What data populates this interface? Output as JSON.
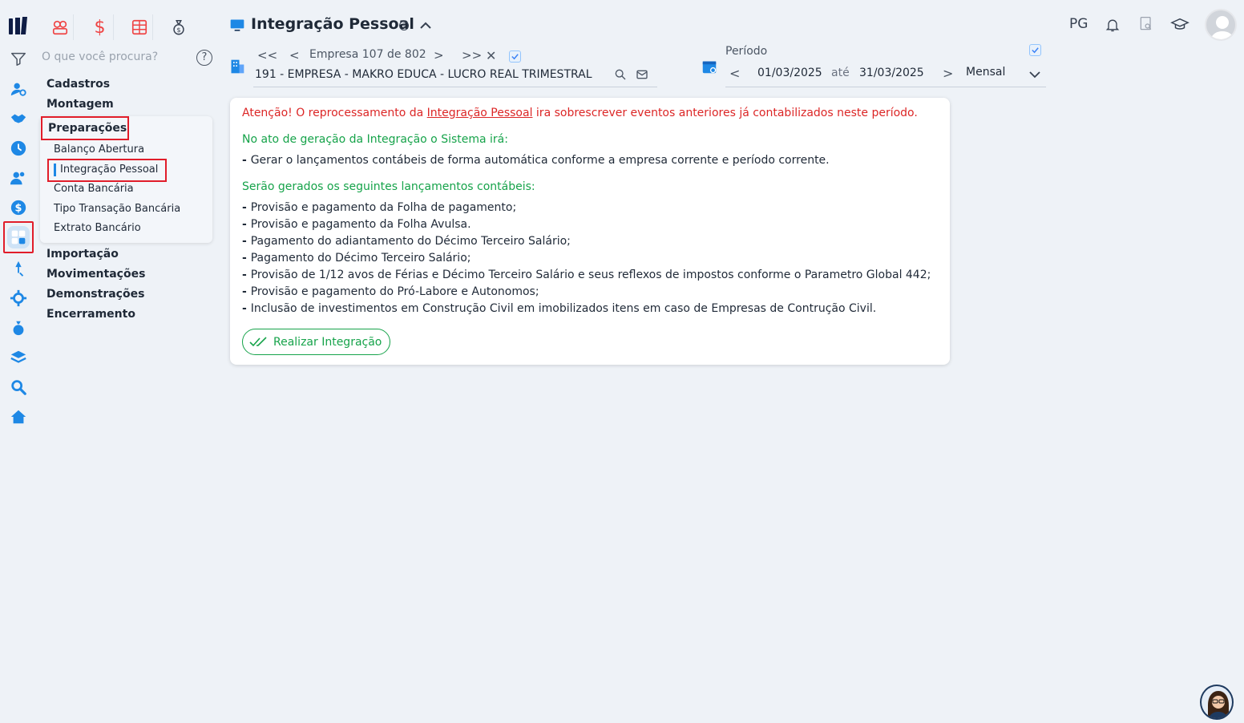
{
  "app": {
    "logo": "logo",
    "page_title": "Integração Pessoal",
    "user_initials": "PG"
  },
  "top_apps": [
    {
      "icon": "people-icon"
    },
    {
      "icon": "dollar-icon"
    },
    {
      "icon": "calculator-grid-icon"
    },
    {
      "icon": "money-bag-icon"
    }
  ],
  "menu": {
    "search_placeholder": "O que você procura?",
    "groups": [
      "Cadastros",
      "Montagem",
      "Preparações",
      "Importação",
      "Movimentações",
      "Demonstrações",
      "Encerramento"
    ],
    "preparacoes_items": [
      "Balanço Abertura",
      "Integração Pessoal",
      "Conta Bancária",
      "Tipo Transação Bancária",
      "Extrato Bancário"
    ]
  },
  "company": {
    "nav_label": "Empresa",
    "current": "107",
    "of_label": "de",
    "total": "802",
    "name": "191 - EMPRESA - MAKRO EDUCA - LUCRO REAL TRIMESTRAL"
  },
  "period": {
    "label": "Período",
    "start": "01/03/2025",
    "until_label": "até",
    "end": "31/03/2025",
    "frequency": "Mensal"
  },
  "content": {
    "warning_prefix": "Atenção! O reprocessamento da ",
    "warning_link": "Integração Pessoal",
    "warning_suffix": " ira sobrescrever eventos anteriores já contabilizados neste período.",
    "section1_title": "No ato de geração da Integração o Sistema irá:",
    "section1_items": [
      "Gerar o lançamentos contábeis de forma automática conforme a empresa corrente e período corrente."
    ],
    "section2_title": "Serão gerados os seguintes lançamentos contábeis:",
    "section2_items": [
      "Provisão e pagamento da Folha de pagamento;",
      "Provisão e pagamento da Folha Avulsa.",
      "Pagamento do adiantamento do Décimo Terceiro Salário;",
      "Pagamento do Décimo Terceiro Salário;",
      "Provisão de 1/12 avos de Férias e Décimo Terceiro Salário e seus reflexos de impostos conforme o Parametro Global 442;",
      "Provisão e pagamento do Pró-Labore e Autonomos;",
      "Inclusão de investimentos em Construção Civil em imobilizados itens em caso de Empresas de Contrução Civil."
    ],
    "button_label": "Realizar Integração"
  },
  "colors": {
    "accent_blue": "#1e88e5",
    "warning_red": "#dc2626",
    "success_green": "#16a34a",
    "highlight_red": "#e11d2a"
  }
}
